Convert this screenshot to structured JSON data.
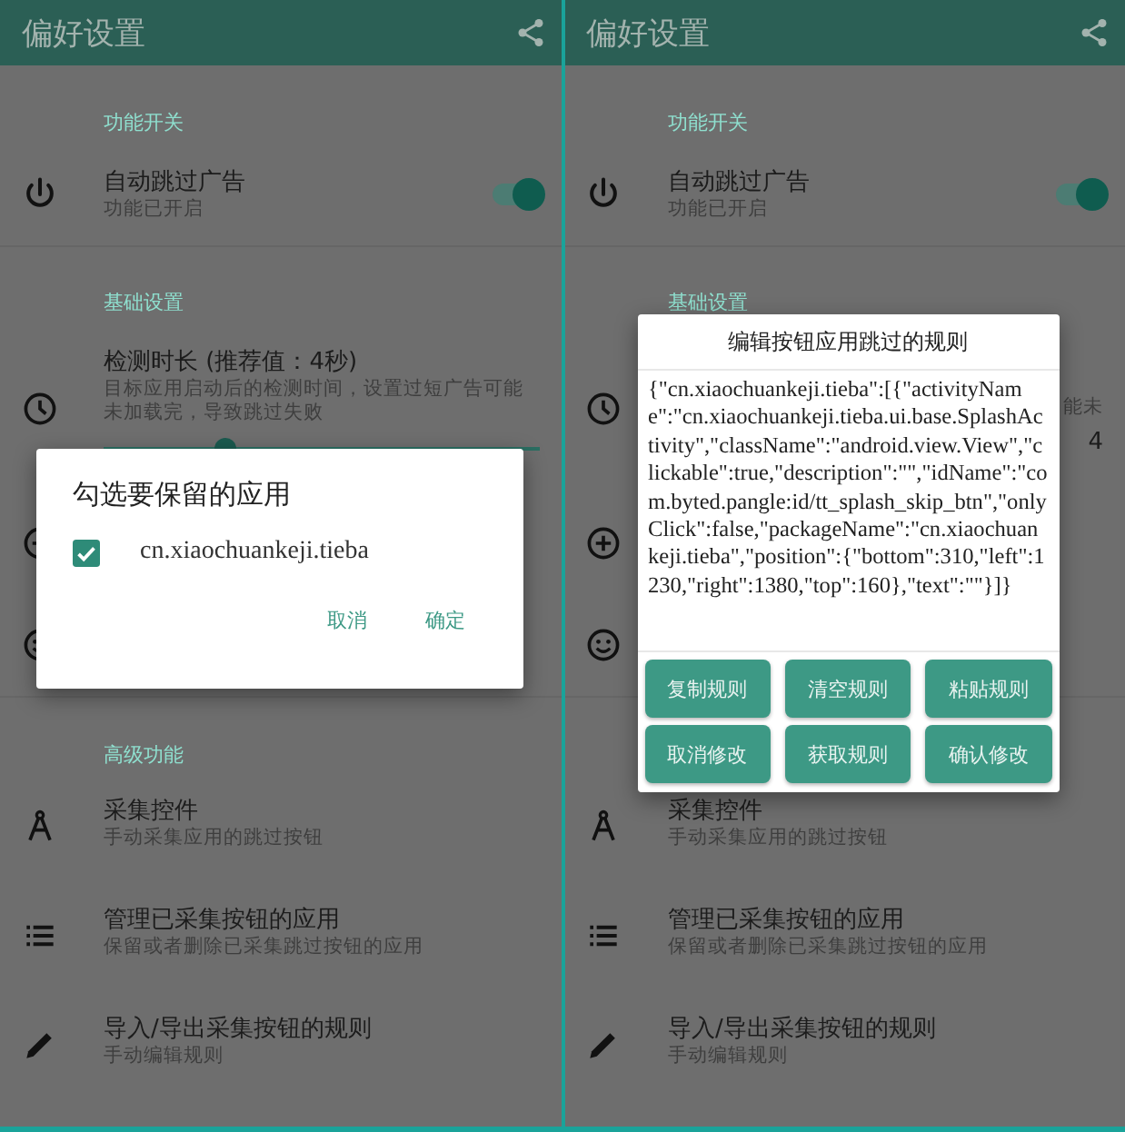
{
  "panels": [
    {
      "app_bar": {
        "title": "偏好设置"
      },
      "sections": [
        {
          "header": "功能开关",
          "items": [
            {
              "title": "自动跳过广告",
              "subtitle": "功能已开启",
              "toggle_on": true
            }
          ]
        },
        {
          "header": "基础设置",
          "items": [
            {
              "title": "检测时长 (推荐值：4秒)",
              "subtitle": "目标应用启动后的检测时间，设置过短广告可能未加载完，导致跳过失败",
              "level": 0.28
            },
            {
              "kind": "covered"
            },
            {
              "kind": "covered"
            }
          ]
        },
        {
          "header": "高级功能",
          "items": [
            {
              "title": "采集控件",
              "subtitle": "手动采集应用的跳过按钮"
            },
            {
              "title": "管理已采集按钮的应用",
              "subtitle": "保留或者删除已采集跳过按钮的应用"
            },
            {
              "title": "导入/导出采集按钮的规则",
              "subtitle": "手动编辑规则"
            }
          ]
        }
      ],
      "dialog": {
        "kind": "checklist",
        "title": "勾选要保留的应用",
        "options": [
          {
            "label": "cn.xiaochuankeji.tieba",
            "checked": true
          }
        ],
        "buttons": [
          "取消",
          "确定"
        ]
      }
    },
    {
      "app_bar": {
        "title": "偏好设置"
      },
      "sections": [
        {
          "header": "功能开关",
          "items": [
            {
              "title": "自动跳过广告",
              "subtitle": "功能已开启",
              "toggle_on": true
            }
          ]
        },
        {
          "header": "基础设置",
          "items": [
            {
              "subtitle_tail": "能未",
              "slider_value": "4"
            },
            {
              "kind": "covered"
            },
            {
              "kind": "covered"
            }
          ]
        },
        {
          "items": [
            {
              "title": "采集控件",
              "subtitle": "手动采集应用的跳过按钮"
            },
            {
              "title": "管理已采集按钮的应用",
              "subtitle": "保留或者删除已采集跳过按钮的应用"
            },
            {
              "title": "导入/导出采集按钮的规则",
              "subtitle": "手动编辑规则"
            }
          ]
        }
      ],
      "dialog": {
        "kind": "rule_editor",
        "title": "编辑按钮应用跳过的规则",
        "rules": "{\"cn.xiaochuankeji.tieba\":[{\"activityName\":\"cn.xiaochuankeji.tieba.ui.base.SplashActivity\",\"className\":\"android.view.View\",\"clickable\":true,\"description\":\"\",\"idName\":\"com.byted.pangle:id/tt_splash_skip_btn\",\"onlyClick\":false,\"packageName\":\"cn.xiaochuankeji.tieba\",\"position\":{\"bottom\":310,\"left\":1230,\"right\":1380,\"top\":160},\"text\":\"\"}]}",
        "buttons": [
          "复制规则",
          "清空规则",
          "粘贴规则",
          "取消修改",
          "获取规则",
          "确认修改"
        ]
      }
    }
  ]
}
